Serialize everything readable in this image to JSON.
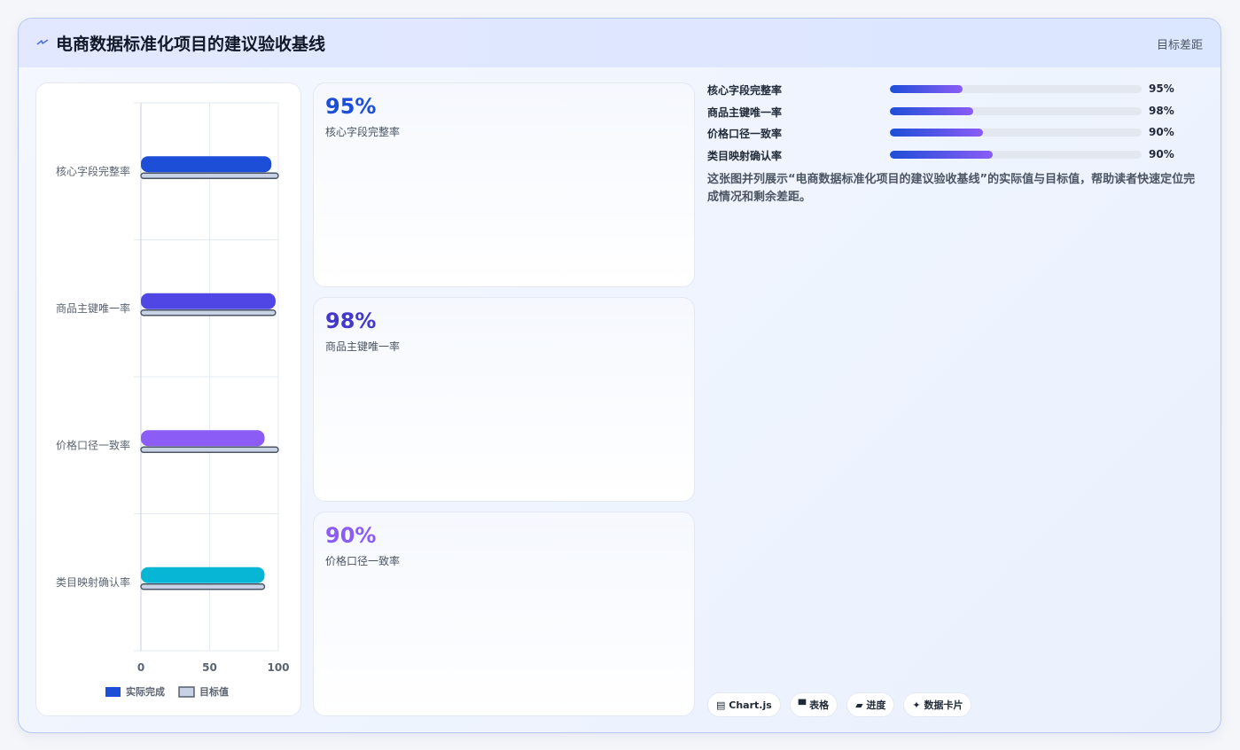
{
  "header": {
    "title": "电商数据标准化项目的建议验收基线",
    "tag": "目标差距",
    "icon": "lightning-icon"
  },
  "chart_data": {
    "type": "bar",
    "orientation": "horizontal",
    "categories": [
      "核心字段完整率",
      "商品主键唯一率",
      "价格口径一致率",
      "类目映射确认率"
    ],
    "series": [
      {
        "name": "实际完成",
        "values": [
          95,
          98,
          90,
          90
        ],
        "colors": [
          "#1d4ed8",
          "#4f46e5",
          "#8b5cf6",
          "#06b6d4"
        ]
      },
      {
        "name": "目标值",
        "values": [
          100,
          98,
          100,
          90
        ],
        "color": "#c7d2e4"
      }
    ],
    "xlim": [
      0,
      100
    ],
    "xticks": [
      "0",
      "50",
      "100"
    ],
    "grid": true,
    "legend": "bottom"
  },
  "stats": [
    {
      "value": "95%",
      "label": "核心字段完整率",
      "color": "#1d4ed8"
    },
    {
      "value": "98%",
      "label": "商品主键唯一率",
      "color": "#4338ca"
    },
    {
      "value": "90%",
      "label": "价格口径一致率",
      "color": "#8b5cf6"
    }
  ],
  "progress": [
    {
      "label": "核心字段完整率",
      "value": "95%",
      "fill": 0.29
    },
    {
      "label": "商品主键唯一率",
      "value": "98%",
      "fill": 0.33
    },
    {
      "label": "价格口径一致率",
      "value": "90%",
      "fill": 0.37
    },
    {
      "label": "类目映射确认率",
      "value": "90%",
      "fill": 0.41
    }
  ],
  "description": "这张图并列展示“电商数据标准化项目的建议验收基线”的实际值与目标值，帮助读者快速定位完成情况和剩余差距。",
  "chips": [
    {
      "icon": "chart-icon",
      "glyph": "▤",
      "label": "Chart.js"
    },
    {
      "icon": "table-icon",
      "glyph": "▀",
      "label": "表格"
    },
    {
      "icon": "progress-icon",
      "glyph": "▰",
      "label": "进度"
    },
    {
      "icon": "sparkle-icon",
      "glyph": "✦",
      "label": "数据卡片"
    }
  ]
}
